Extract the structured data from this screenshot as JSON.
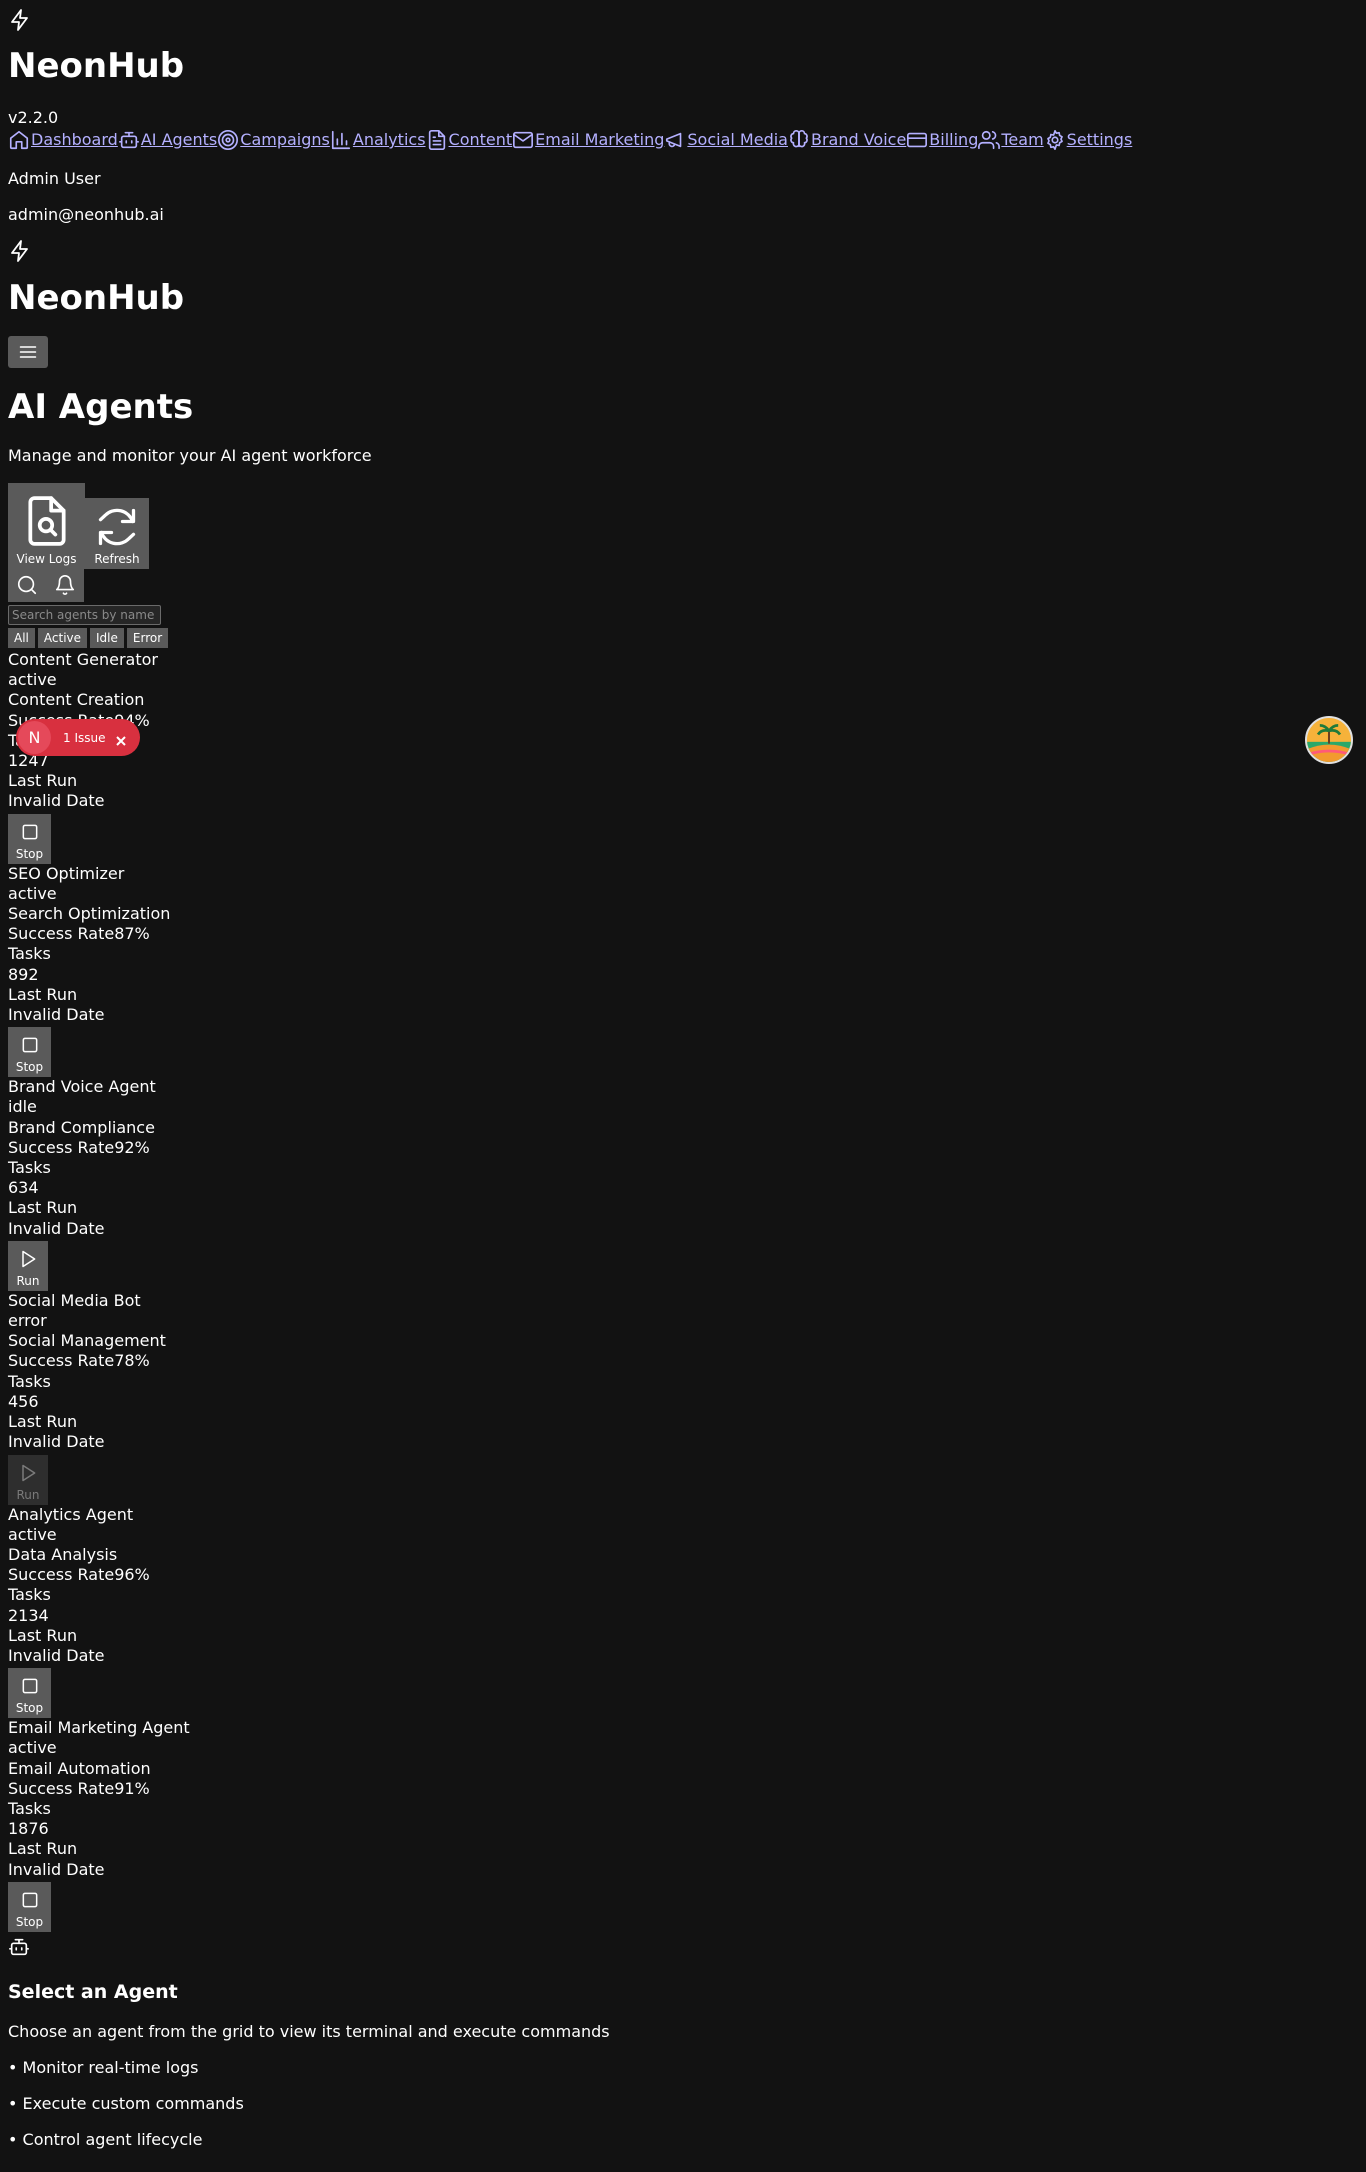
{
  "sidebar": {
    "brand": "NeonHub",
    "version": "v2.2.0",
    "nav": [
      {
        "label": "Dashboard",
        "icon": "home-icon"
      },
      {
        "label": "AI Agents",
        "icon": "bot-icon"
      },
      {
        "label": "Campaigns",
        "icon": "target-icon"
      },
      {
        "label": "Analytics",
        "icon": "bar-chart-icon"
      },
      {
        "label": "Content",
        "icon": "file-text-icon"
      },
      {
        "label": "Email Marketing",
        "icon": "mail-icon"
      },
      {
        "label": "Social Media",
        "icon": "megaphone-icon"
      },
      {
        "label": "Brand Voice",
        "icon": "brain-icon"
      },
      {
        "label": "Billing",
        "icon": "credit-card-icon"
      },
      {
        "label": "Team",
        "icon": "users-icon"
      },
      {
        "label": "Settings",
        "icon": "settings-icon"
      }
    ],
    "user": {
      "name": "Admin User",
      "email": "admin@neonhub.ai"
    }
  },
  "mobile_header": {
    "brand": "NeonHub"
  },
  "page": {
    "title": "AI Agents",
    "subtitle": "Manage and monitor your AI agent workforce",
    "actions": {
      "view_logs": "View Logs",
      "refresh": "Refresh"
    },
    "search_placeholder": "Search agents by name",
    "filters": [
      "All",
      "Active",
      "Idle",
      "Error"
    ]
  },
  "labels": {
    "success_rate": "Success Rate",
    "tasks": "Tasks",
    "last_run": "Last Run"
  },
  "agents": [
    {
      "name": "Content Generator",
      "status": "active",
      "type": "Content Creation",
      "success_rate": "94%",
      "tasks": "1247",
      "last_run": "Invalid Date",
      "action": "Stop"
    },
    {
      "name": "SEO Optimizer",
      "status": "active",
      "type": "Search Optimization",
      "success_rate": "87%",
      "tasks": "892",
      "last_run": "Invalid Date",
      "action": "Stop"
    },
    {
      "name": "Brand Voice Agent",
      "status": "idle",
      "type": "Brand Compliance",
      "success_rate": "92%",
      "tasks": "634",
      "last_run": "Invalid Date",
      "action": "Run"
    },
    {
      "name": "Social Media Bot",
      "status": "error",
      "type": "Social Management",
      "success_rate": "78%",
      "tasks": "456",
      "last_run": "Invalid Date",
      "action": "Run"
    },
    {
      "name": "Analytics Agent",
      "status": "active",
      "type": "Data Analysis",
      "success_rate": "96%",
      "tasks": "2134",
      "last_run": "Invalid Date",
      "action": "Stop"
    },
    {
      "name": "Email Marketing Agent",
      "status": "active",
      "type": "Email Automation",
      "success_rate": "91%",
      "tasks": "1876",
      "last_run": "Invalid Date",
      "action": "Stop"
    }
  ],
  "terminal_placeholder": {
    "title": "Select an Agent",
    "subtitle": "Choose an agent from the grid to view its terminal and execute commands",
    "bullets": [
      "• Monitor real-time logs",
      "• Execute custom commands",
      "• Control agent lifecycle"
    ]
  },
  "issue_badge": {
    "letter": "N",
    "text": "1 Issue"
  },
  "colors": {
    "background": "#121212",
    "link": "#b4b0ff",
    "button": "#5a5a5a",
    "issue": "#d8303f"
  }
}
